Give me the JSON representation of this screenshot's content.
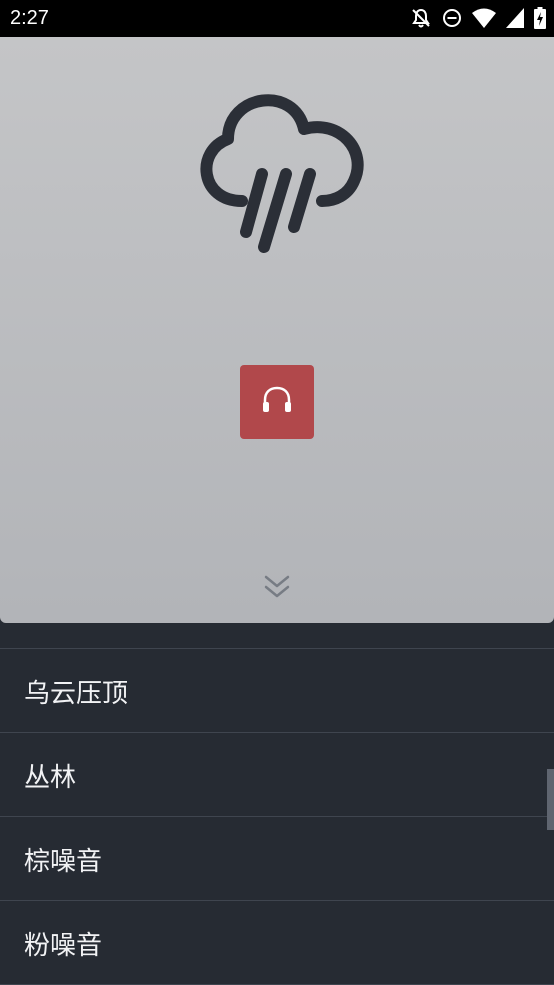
{
  "status_bar": {
    "time": "2:27",
    "icons": [
      "notifications-off-icon",
      "do-not-disturb-icon",
      "wifi-icon",
      "cellular-signal-icon",
      "battery-charging-icon"
    ]
  },
  "hero": {
    "icon": "rain-cloud-icon",
    "play_button_icon": "headphones-icon",
    "expand_icon": "chevron-double-down-icon",
    "accent_color": "#b1484b"
  },
  "sound_list": {
    "items": [
      {
        "label": "乌云压顶"
      },
      {
        "label": "丛林"
      },
      {
        "label": "棕噪音"
      },
      {
        "label": "粉噪音"
      }
    ]
  }
}
